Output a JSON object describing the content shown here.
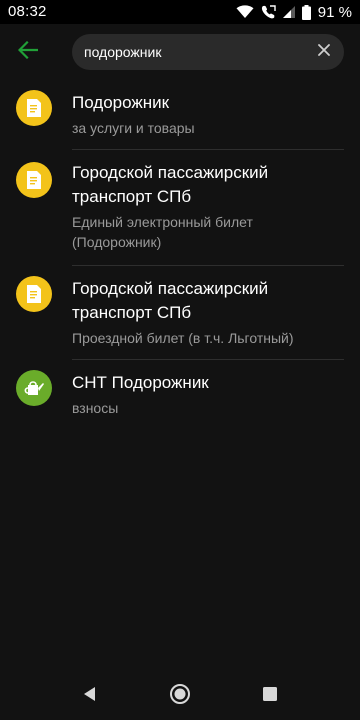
{
  "status_bar": {
    "time": "08:32",
    "battery_percent": "91 %",
    "icons": [
      "wifi-icon",
      "volte-call-icon",
      "signal-icon",
      "battery-icon"
    ]
  },
  "app_bar": {
    "back_icon": "arrow-left-icon",
    "search": {
      "value": "подорожник",
      "placeholder": ""
    },
    "clear_icon": "close-icon"
  },
  "results": [
    {
      "icon": "document-icon",
      "title": "Подорожник",
      "subtitle": "за услуги и товары"
    },
    {
      "icon": "document-icon",
      "title": "Городской пассажирский транспорт СПб",
      "subtitle": "Единый электронный билет (Подорожник)"
    },
    {
      "icon": "document-icon",
      "title": "Городской пассажирский транспорт СПб",
      "subtitle": "Проездной билет (в т.ч. Льготный)"
    },
    {
      "icon": "watering-can-icon",
      "title": "СНТ Подорожник",
      "subtitle": "взносы"
    }
  ],
  "colors": {
    "accent_green": "#21a038",
    "doc_icon_bg": "#f3c31a",
    "coop_icon_bg": "#6aac2a",
    "background": "#121212"
  },
  "nav_bar": {
    "icons": [
      "nav-back-icon",
      "nav-home-icon",
      "nav-recents-icon"
    ]
  }
}
